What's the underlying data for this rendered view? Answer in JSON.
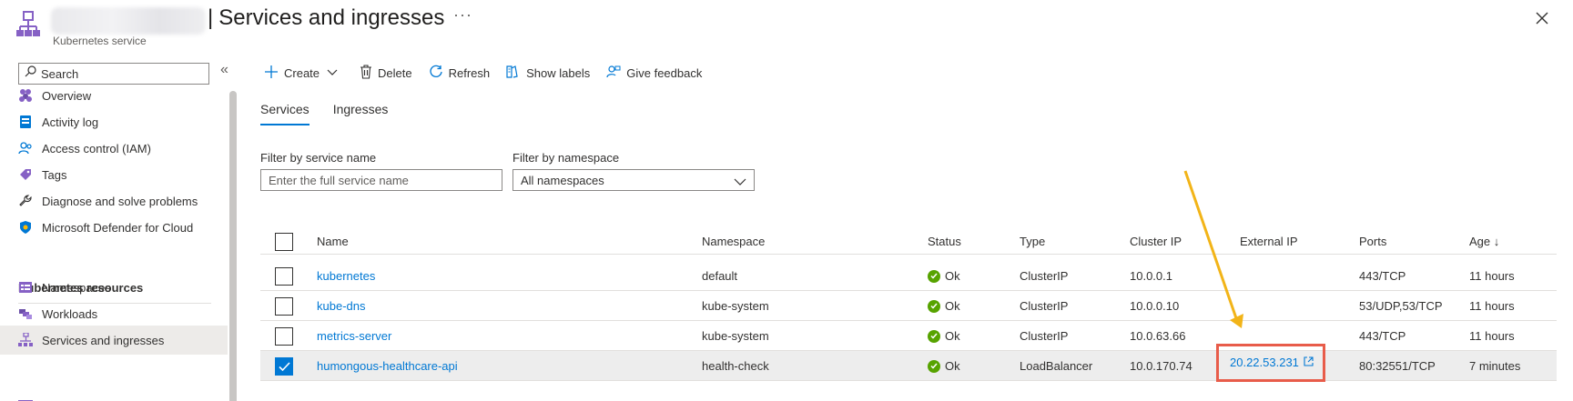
{
  "header": {
    "separator": "|",
    "title": "Services and ingresses",
    "subtitle": "Kubernetes service",
    "more": "···"
  },
  "sidebar": {
    "search_placeholder": "Search",
    "collapse": "«",
    "items": [
      {
        "label": "Overview",
        "icon": "overview-icon"
      },
      {
        "label": "Activity log",
        "icon": "activity-log-icon"
      },
      {
        "label": "Access control (IAM)",
        "icon": "iam-icon"
      },
      {
        "label": "Tags",
        "icon": "tag-icon"
      },
      {
        "label": "Diagnose and solve problems",
        "icon": "wrench-icon"
      },
      {
        "label": "Microsoft Defender for Cloud",
        "icon": "shield-icon"
      }
    ],
    "section_header": "Kubernetes resources",
    "resources": [
      {
        "label": "Namespaces",
        "icon": "namespaces-icon"
      },
      {
        "label": "Workloads",
        "icon": "workloads-icon"
      },
      {
        "label": "Services and ingresses",
        "icon": "services-icon",
        "active": true
      }
    ]
  },
  "toolbar": {
    "create": "Create",
    "delete": "Delete",
    "refresh": "Refresh",
    "show_labels": "Show labels",
    "give_feedback": "Give feedback"
  },
  "tabs": [
    {
      "label": "Services",
      "active": true
    },
    {
      "label": "Ingresses",
      "active": false
    }
  ],
  "filters": {
    "service_name_label": "Filter by service name",
    "service_name_placeholder": "Enter the full service name",
    "namespace_label": "Filter by namespace",
    "namespace_value": "All namespaces"
  },
  "table": {
    "columns": [
      "Name",
      "Namespace",
      "Status",
      "Type",
      "Cluster IP",
      "External IP",
      "Ports",
      "Age ↓"
    ],
    "rows": [
      {
        "name": "kubernetes",
        "namespace": "default",
        "status": "Ok",
        "type": "ClusterIP",
        "cluster_ip": "10.0.0.1",
        "external_ip": "",
        "ports": "443/TCP",
        "age": "11 hours",
        "selected": false
      },
      {
        "name": "kube-dns",
        "namespace": "kube-system",
        "status": "Ok",
        "type": "ClusterIP",
        "cluster_ip": "10.0.0.10",
        "external_ip": "",
        "ports": "53/UDP,53/TCP",
        "age": "11 hours",
        "selected": false
      },
      {
        "name": "metrics-server",
        "namespace": "kube-system",
        "status": "Ok",
        "type": "ClusterIP",
        "cluster_ip": "10.0.63.66",
        "external_ip": "",
        "ports": "443/TCP",
        "age": "11 hours",
        "selected": false
      },
      {
        "name": "humongous-healthcare-api",
        "namespace": "health-check",
        "status": "Ok",
        "type": "LoadBalancer",
        "cluster_ip": "10.0.170.74",
        "external_ip": "20.22.53.231",
        "ports": "80:32551/TCP",
        "age": "7 minutes",
        "selected": true
      }
    ]
  },
  "colors": {
    "accent": "#0078d4",
    "status_ok": "#57a300",
    "highlight_box": "#e85c4a",
    "arrow": "#f2b418",
    "brand_purple": "#8661c5"
  }
}
